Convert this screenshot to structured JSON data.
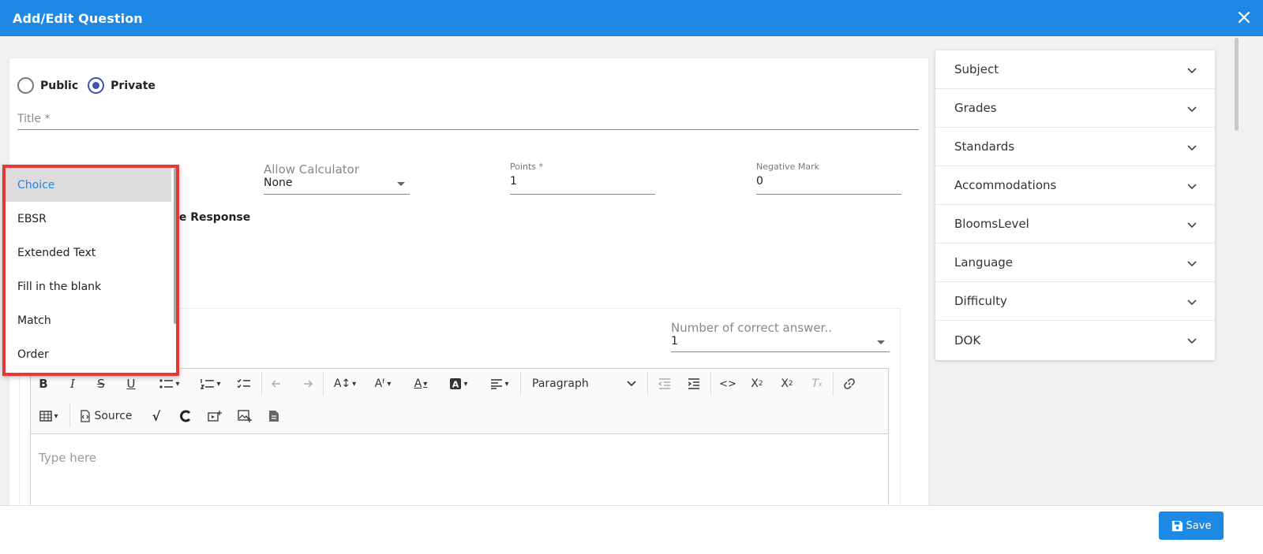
{
  "header": {
    "title": "Add/Edit Question"
  },
  "visibility": {
    "public_label": "Public",
    "private_label": "Private",
    "selected": "Private"
  },
  "title_field": {
    "placeholder": "Title *"
  },
  "allow_calculator": {
    "label": "Allow Calculator",
    "value": "None"
  },
  "points": {
    "label": "Points *",
    "value": "1"
  },
  "negative_mark": {
    "label": "Negative Mark",
    "value": "0"
  },
  "partial_text": "ple Response",
  "question_type_dropdown": {
    "options": [
      "Choice",
      "EBSR",
      "Extended Text",
      "Fill in the blank",
      "Match",
      "Order"
    ],
    "selected": "Choice"
  },
  "correct_answers": {
    "label": "Number of correct answer..",
    "value": "1"
  },
  "toolbar": {
    "paragraph_label": "Paragraph",
    "source_label": "Source"
  },
  "editor": {
    "placeholder": "Type here"
  },
  "side_panel": {
    "items": [
      "Subject",
      "Grades",
      "Standards",
      "Accommodations",
      "BloomsLevel",
      "Language",
      "Difficulty",
      "DOK"
    ]
  },
  "footer": {
    "save_label": "Save"
  },
  "colors": {
    "primary": "#1e88e5",
    "highlight": "#e53935",
    "radio": "#3f51b5"
  }
}
